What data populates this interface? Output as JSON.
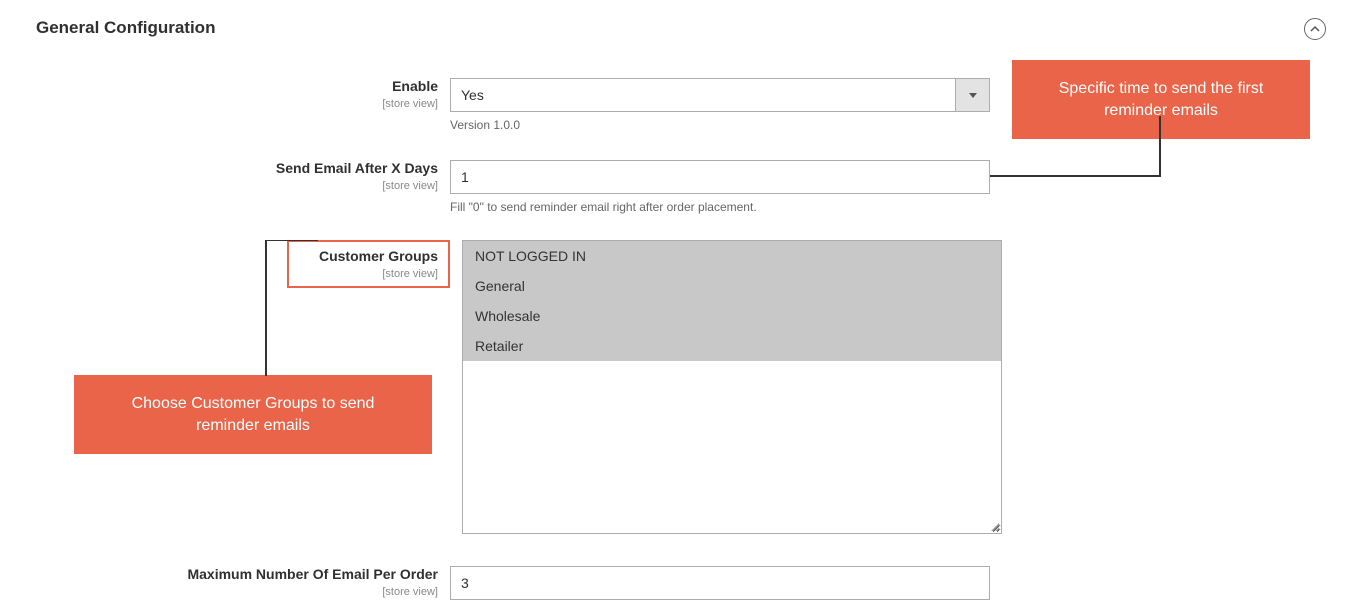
{
  "section": {
    "title": "General Configuration"
  },
  "fields": {
    "enable": {
      "label": "Enable",
      "scope": "[store view]",
      "value": "Yes",
      "help": "Version 1.0.0"
    },
    "send_after": {
      "label": "Send Email After X Days",
      "scope": "[store view]",
      "value": "1",
      "help": "Fill \"0\" to send reminder email right after order placement."
    },
    "customer_groups": {
      "label": "Customer Groups",
      "scope": "[store view]",
      "options": [
        "NOT LOGGED IN",
        "General",
        "Wholesale",
        "Retailer"
      ]
    },
    "max_email": {
      "label": "Maximum Number Of Email Per Order",
      "scope": "[store view]",
      "value": "3"
    }
  },
  "callouts": {
    "c1": "Specific time to send the first reminder emails",
    "c2": "Choose Customer Groups to send reminder emails"
  }
}
